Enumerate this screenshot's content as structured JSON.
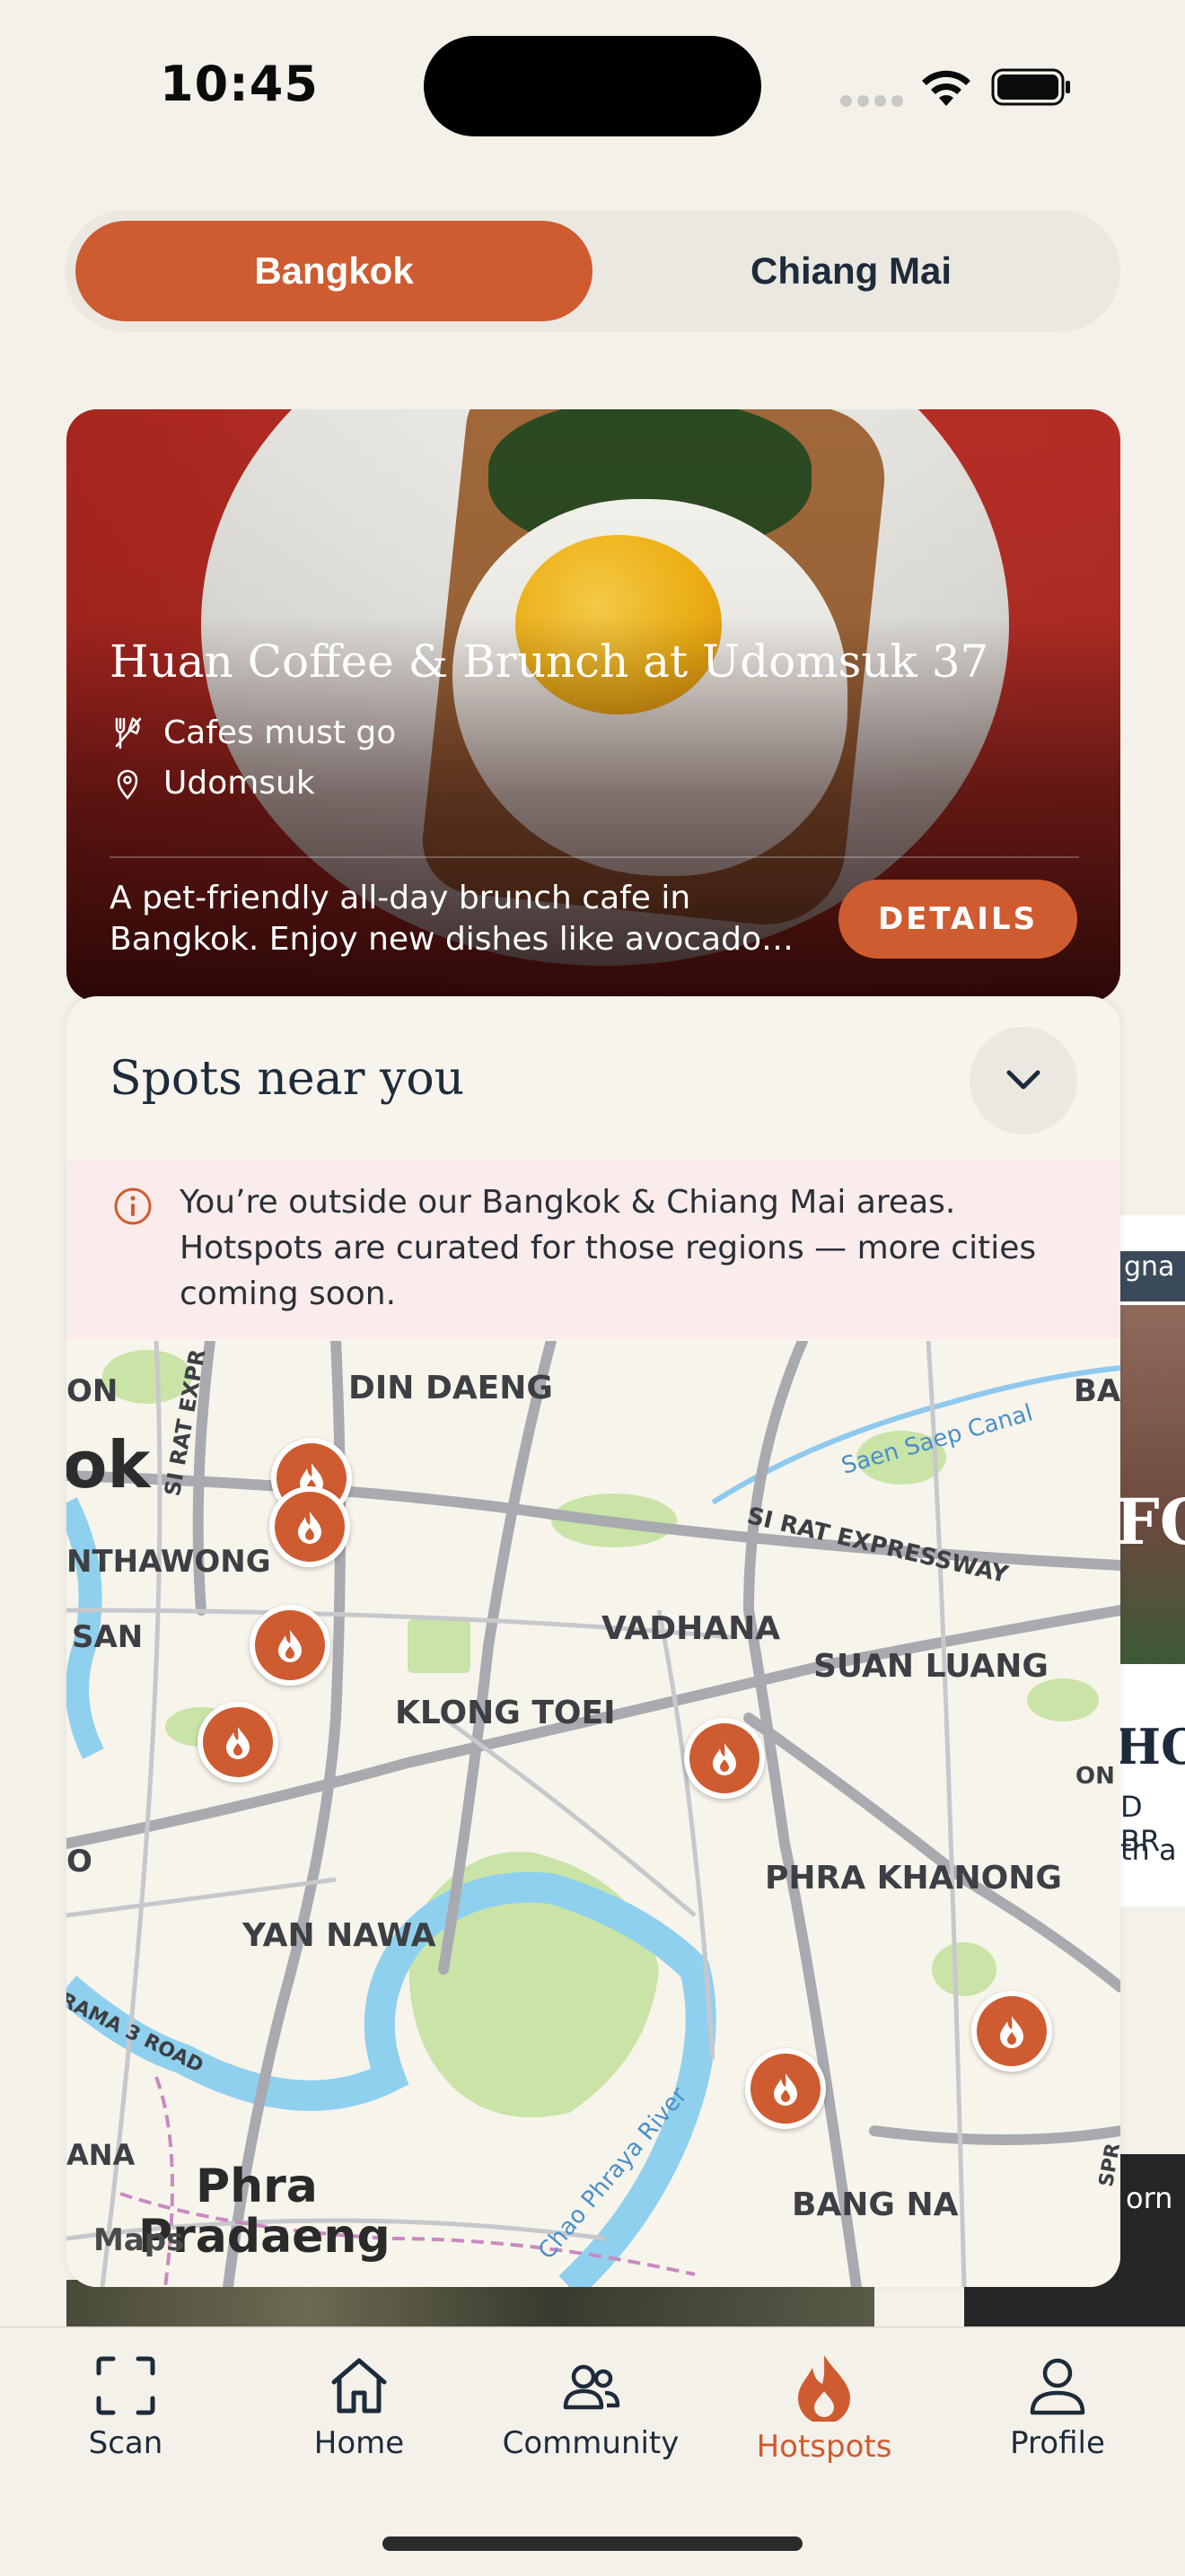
{
  "status_bar": {
    "time": "10:45"
  },
  "city_switch": {
    "active": "Bangkok",
    "inactive": "Chiang Mai"
  },
  "hero": {
    "title": "Huan Coffee & Brunch at Udomsuk 37",
    "category": "Cafes must go",
    "location": "Udomsuk",
    "description": "A pet-friendly all-day brunch cafe in Bangkok. Enjoy new dishes like avocado…",
    "details_label": "DETAILS"
  },
  "peek_card": {
    "tag": "gna",
    "big": "FO",
    "heading": "HO",
    "line1": "D BR",
    "line2": "th a",
    "bottom_tag": "orn"
  },
  "spots": {
    "title": "Spots near you",
    "notice": "You’re outside our Bangkok & Chiang Mai areas. Hotspots are curated for those regions — more cities coming soon."
  },
  "map": {
    "attribution": "Maps",
    "labels": {
      "din_daeng": "DIN DAENG",
      "ok": "ok",
      "thawong": "NTHAWONG",
      "san": "SAN",
      "vadhana": "VADHANA",
      "suan_luang": "SUAN LUANG",
      "klong_toei": "KLONG TOEI",
      "phra_khanong": "PHRA KHANONG",
      "yan_nawa": "YAN NAWA",
      "bang_na": "BANG NA",
      "phra": "Phra",
      "pradaeng": "Pradaeng",
      "ana": "ANA",
      "o": "O",
      "on": "ON",
      "ba": "BA",
      "sirat_expressway": "SI RAT EXPRESSWAY",
      "sirat_exp_left": "SI RAT EXPR",
      "saen_saep": "Saen Saep Canal",
      "chao_phraya": "Chao Phraya River",
      "rama3": "RAMA 3 ROAD",
      "spr": "SPR"
    }
  },
  "tabs": [
    {
      "label": "Scan",
      "icon": "scan-icon"
    },
    {
      "label": "Home",
      "icon": "home-icon"
    },
    {
      "label": "Community",
      "icon": "community-icon"
    },
    {
      "label": "Hotspots",
      "icon": "flame-icon"
    },
    {
      "label": "Profile",
      "icon": "profile-icon"
    }
  ],
  "colors": {
    "accent": "#cf5b30",
    "background": "#f4f1ea",
    "text": "#1d2b3a"
  }
}
